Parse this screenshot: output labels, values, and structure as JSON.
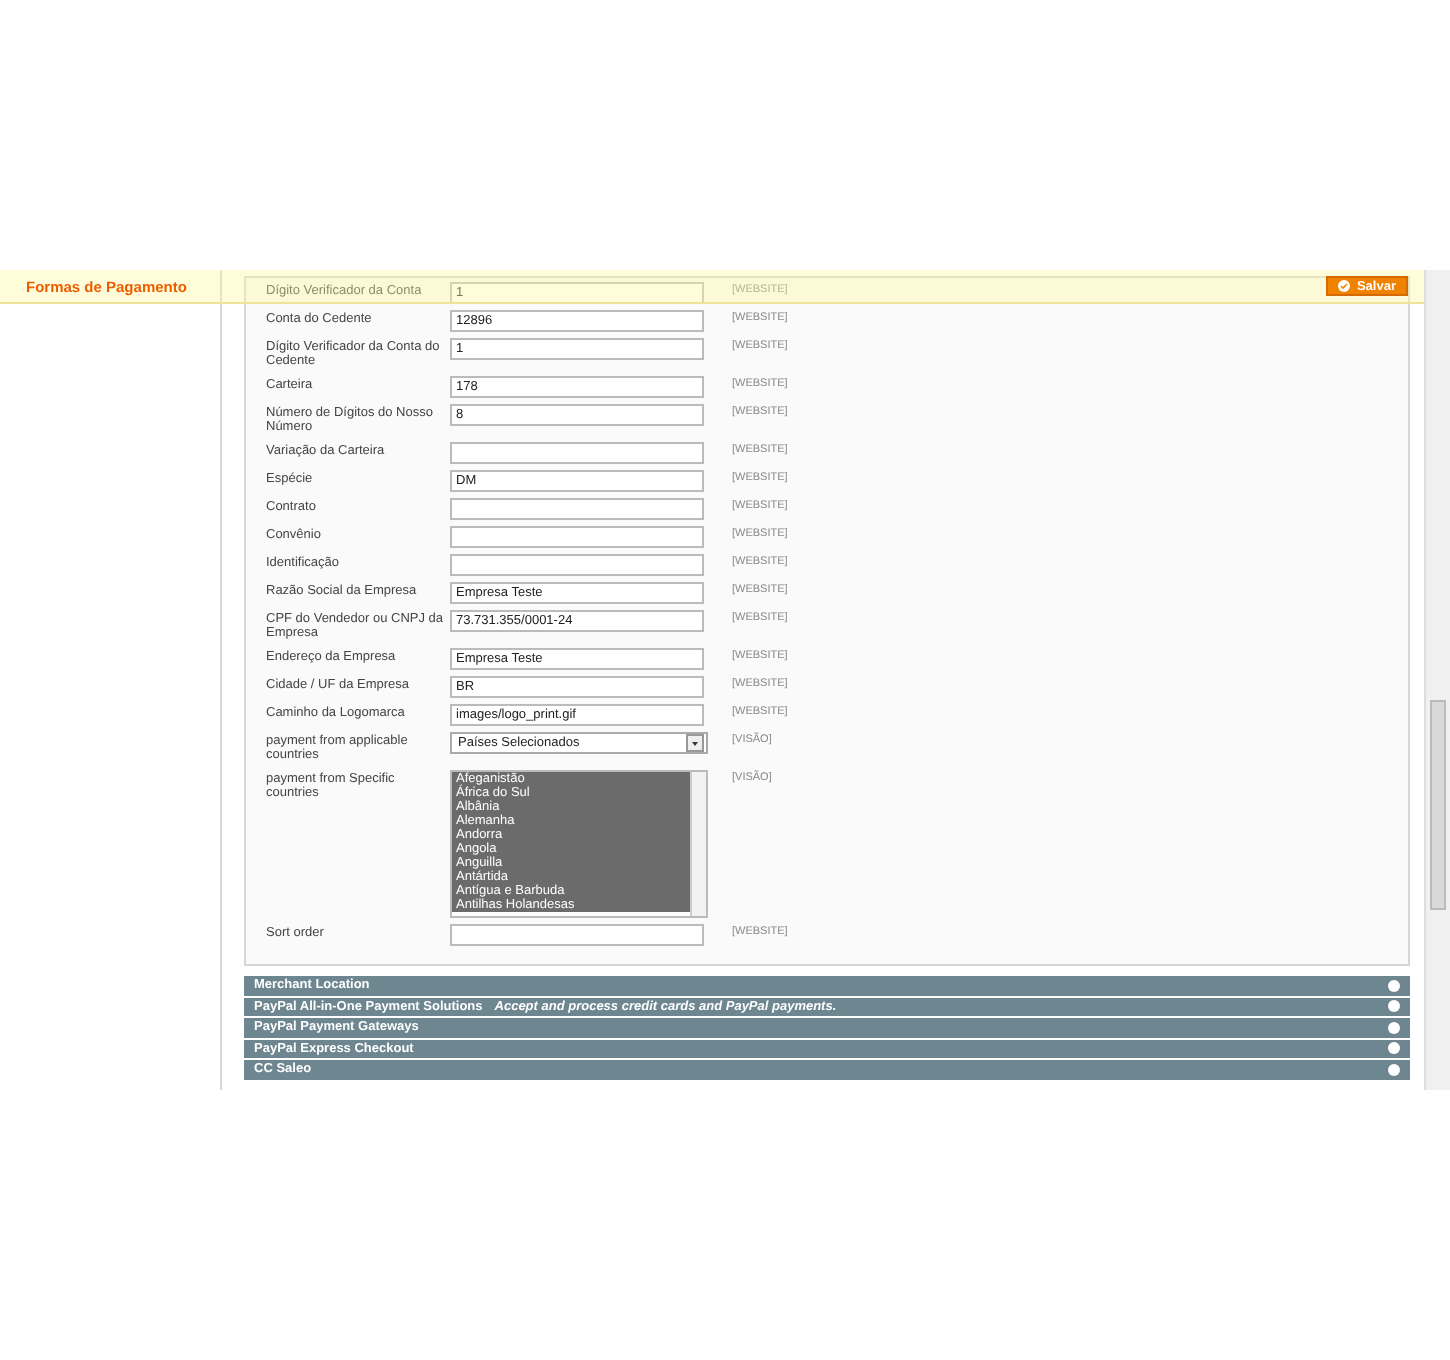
{
  "header": {
    "title": "Formas de Pagamento",
    "save_button": "Salvar"
  },
  "fields": [
    {
      "kind": "text",
      "label": "Dígito Verificador da Conta",
      "value": "1",
      "scope": "[WEBSITE]"
    },
    {
      "kind": "text",
      "label": "Conta do Cedente",
      "value": "12896",
      "scope": "[WEBSITE]"
    },
    {
      "kind": "text",
      "label": "Dígito Verificador da Conta do Cedente",
      "value": "1",
      "scope": "[WEBSITE]"
    },
    {
      "kind": "text",
      "label": "Carteira",
      "value": "178",
      "scope": "[WEBSITE]"
    },
    {
      "kind": "text",
      "label": "Número de Dígitos do Nosso Número",
      "value": "8",
      "scope": "[WEBSITE]"
    },
    {
      "kind": "text",
      "label": "Variação da Carteira",
      "scope": "[WEBSITE]"
    },
    {
      "kind": "text",
      "label": "Espécie",
      "value": "DM",
      "scope": "[WEBSITE]"
    },
    {
      "kind": "text",
      "label": "Contrato",
      "scope": "[WEBSITE]"
    },
    {
      "kind": "text",
      "label": "Convênio",
      "scope": "[WEBSITE]"
    },
    {
      "kind": "text",
      "label": "Identificação",
      "scope": "[WEBSITE]"
    },
    {
      "kind": "text",
      "label": "Razão Social da Empresa",
      "value": "Empresa Teste",
      "scope": "[WEBSITE]"
    },
    {
      "kind": "text",
      "label": "CPF do Vendedor ou CNPJ da Empresa",
      "value": "73.731.355/0001-24",
      "scope": "[WEBSITE]"
    },
    {
      "kind": "text",
      "label": "Endereço da Empresa",
      "value": "Empresa Teste",
      "scope": "[WEBSITE]"
    },
    {
      "kind": "text",
      "label": "Cidade / UF da Empresa",
      "value": "BR",
      "scope": "[WEBSITE]"
    },
    {
      "kind": "text",
      "label": "Caminho da Logomarca",
      "value": "images/logo_print.gif",
      "scope": "[WEBSITE]"
    },
    {
      "kind": "select",
      "label": "payment from applicable countries",
      "value": "Países Selecionados",
      "scope": "[VISÃO]"
    },
    {
      "kind": "multiselect",
      "label": "payment from Specific countries",
      "scope": "[VISÃO]",
      "options": [
        {
          "label": "Afeganistão",
          "selected": true
        },
        {
          "label": "África do Sul",
          "selected": true
        },
        {
          "label": "Albânia",
          "selected": true
        },
        {
          "label": "Alemanha",
          "selected": true
        },
        {
          "label": "Andorra",
          "selected": true
        },
        {
          "label": "Angola",
          "selected": true
        },
        {
          "label": "Anguilla",
          "selected": true
        },
        {
          "label": "Antártida",
          "selected": true
        },
        {
          "label": "Antígua e Barbuda",
          "selected": true
        },
        {
          "label": "Antilhas Holandesas",
          "selected": true
        }
      ]
    },
    {
      "kind": "text",
      "label": "Sort order",
      "scope": "[WEBSITE]"
    }
  ],
  "sections": [
    {
      "title": "Merchant Location"
    },
    {
      "title": "PayPal All-in-One Payment Solutions",
      "note": "Accept and process credit cards and PayPal payments."
    },
    {
      "title": "PayPal Payment Gateways"
    },
    {
      "title": "PayPal Express Checkout"
    },
    {
      "title": "CC Saleo"
    }
  ]
}
